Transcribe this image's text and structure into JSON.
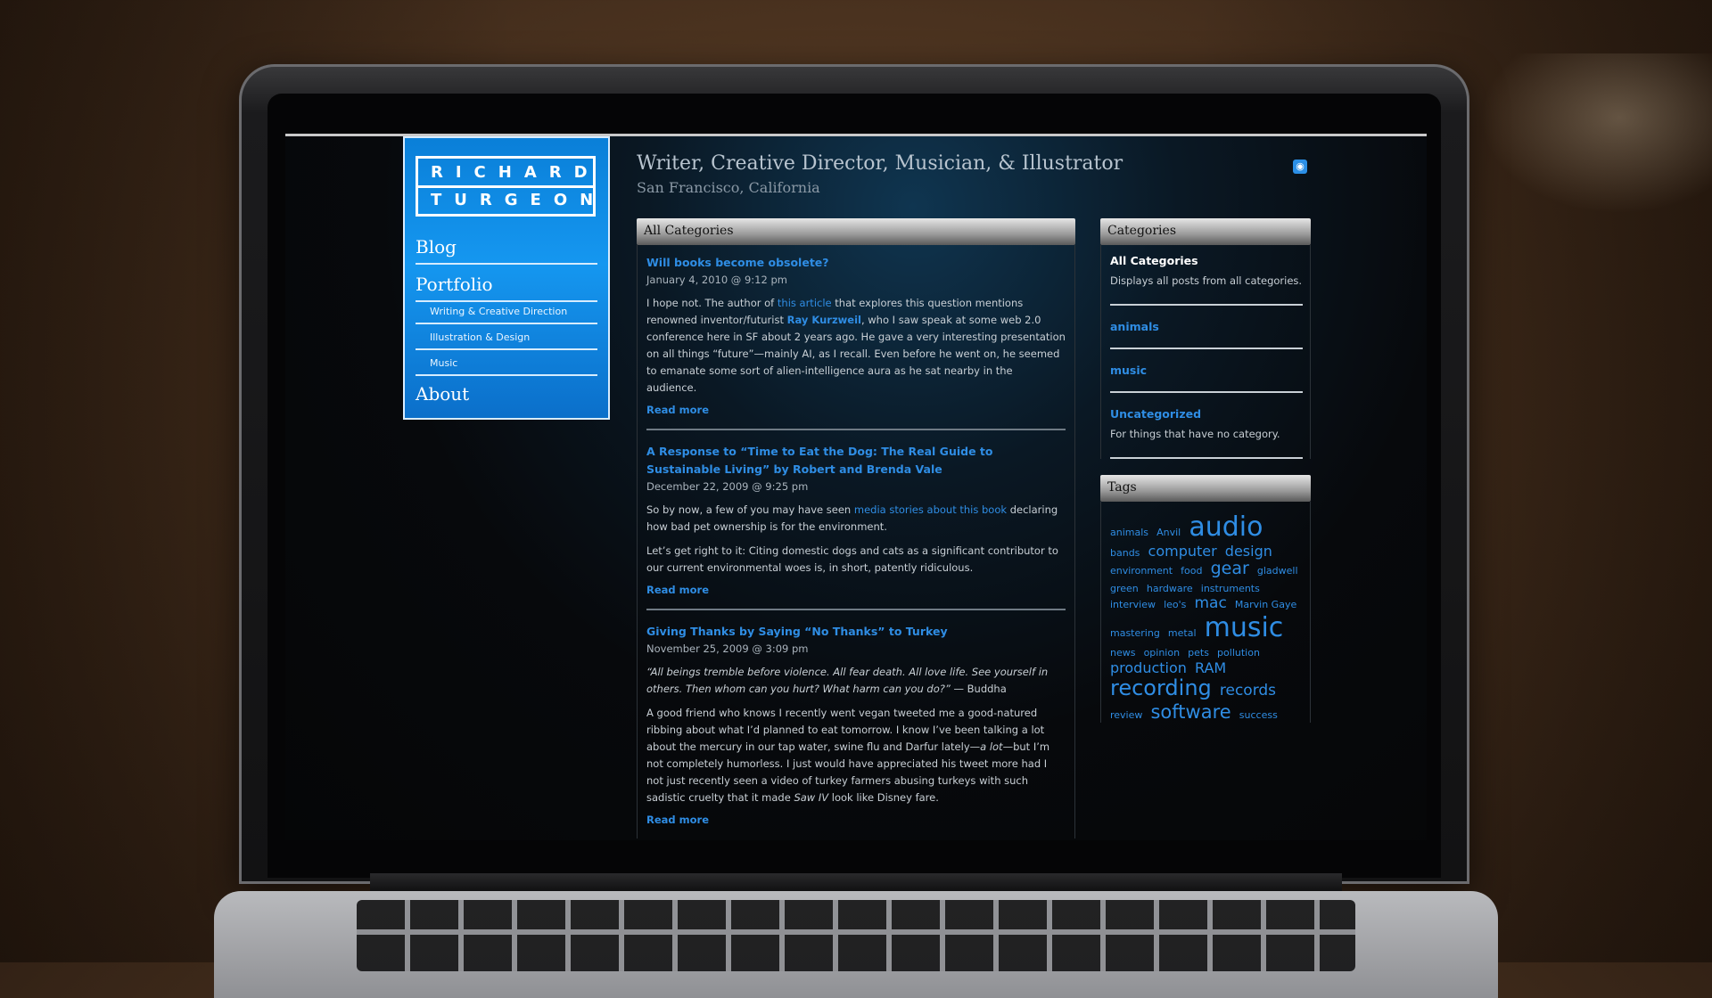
{
  "logo": {
    "line1": "RICHARD",
    "line2": "TURGEON"
  },
  "nav": {
    "blog": "Blog",
    "portfolio": "Portfolio",
    "sub": [
      "Writing & Creative Direction",
      "Illustration & Design",
      "Music"
    ],
    "about": "About"
  },
  "header": {
    "title": "Writer, Creative Director, Musician, & Illustrator",
    "subtitle": "San Francisco, California",
    "rss_icon": "rss-icon"
  },
  "main": {
    "heading": "All Categories",
    "read_more": "Read more",
    "posts": [
      {
        "title": "Will books become obsolete?",
        "date": "January 4, 2010 @ 9:12 pm",
        "p1": {
          "a": "I hope not. The author of ",
          "link1": "this article",
          "b": " that explores this question mentions renowned inventor/futurist ",
          "link2": "Ray Kurzweil",
          "c": ", who I saw speak at some web 2.0 conference here in SF about 2 years ago. He gave a very interesting presentation on all things “future”—mainly AI, as I recall. Even before he went on, he seemed to emanate some sort of alien-intelligence aura as he sat nearby in the audience."
        }
      },
      {
        "title": "A Response to “Time to Eat the Dog: The Real Guide to Sustainable Living” by Robert and Brenda Vale",
        "date": "December 22, 2009 @ 9:25 pm",
        "p1": {
          "a": "So by now, a few of you may have seen ",
          "link1": "media stories about this book",
          "b": " declaring how bad pet ownership is for the environment."
        },
        "p2": "Let’s get right to it: Citing domestic dogs and cats as a significant contributor to our current environmental woes is, in short, patently ridiculous."
      },
      {
        "title": "Giving Thanks by Saying “No Thanks” to Turkey",
        "date": "November 25, 2009 @ 3:09 pm",
        "quote": "“All beings tremble before violence. All fear death. All love life. See yourself in others. Then whom can you hurt? What harm can you do?”",
        "quote_author": " — Buddha",
        "p2": {
          "a": "A good friend who knows I recently went vegan tweeted me a good-natured ribbing about what I’d planned to eat tomorrow. I know I’ve been talking a lot about the mercury in our tap water, swine flu and Darfur lately—",
          "em": "a lot",
          "b": "—but I’m not completely humorless. I just would have appreciated his tweet more had I not just recently seen a video of turkey farmers abusing turkeys with such sadistic cruelty that it made ",
          "em2": "Saw IV",
          "c": " look like Disney fare."
        }
      }
    ]
  },
  "sidebar": {
    "categories_heading": "Categories",
    "categories": [
      {
        "name": "All Categories",
        "desc": "Displays all posts from all categories."
      },
      {
        "name": "animals",
        "desc": ""
      },
      {
        "name": "music",
        "desc": ""
      },
      {
        "name": "Uncategorized",
        "desc": "For things that have no category."
      }
    ],
    "tags_heading": "Tags",
    "tags": [
      {
        "name": "animals",
        "size": 11
      },
      {
        "name": "Anvil",
        "size": 11
      },
      {
        "name": "audio",
        "size": 30
      },
      {
        "name": "bands",
        "size": 11
      },
      {
        "name": "computer",
        "size": 16
      },
      {
        "name": "design",
        "size": 16
      },
      {
        "name": "environment",
        "size": 11
      },
      {
        "name": "food",
        "size": 11
      },
      {
        "name": "gear",
        "size": 19
      },
      {
        "name": "gladwell",
        "size": 11
      },
      {
        "name": "green",
        "size": 11
      },
      {
        "name": "hardware",
        "size": 11
      },
      {
        "name": "instruments",
        "size": 11
      },
      {
        "name": "interview",
        "size": 11
      },
      {
        "name": "leo's",
        "size": 11
      },
      {
        "name": "mac",
        "size": 17
      },
      {
        "name": "Marvin Gaye",
        "size": 11
      },
      {
        "name": "mastering",
        "size": 11
      },
      {
        "name": "metal",
        "size": 11
      },
      {
        "name": "music",
        "size": 30
      },
      {
        "name": "news",
        "size": 11
      },
      {
        "name": "opinion",
        "size": 11
      },
      {
        "name": "pets",
        "size": 11
      },
      {
        "name": "pollution",
        "size": 11
      },
      {
        "name": "production",
        "size": 16
      },
      {
        "name": "RAM",
        "size": 16
      },
      {
        "name": "recording",
        "size": 24
      },
      {
        "name": "records",
        "size": 17
      },
      {
        "name": "review",
        "size": 11
      },
      {
        "name": "software",
        "size": 21
      },
      {
        "name": "success",
        "size": 11
      }
    ]
  },
  "colors": {
    "accent": "#2f8de4",
    "logo_blue": "#1597f0"
  }
}
